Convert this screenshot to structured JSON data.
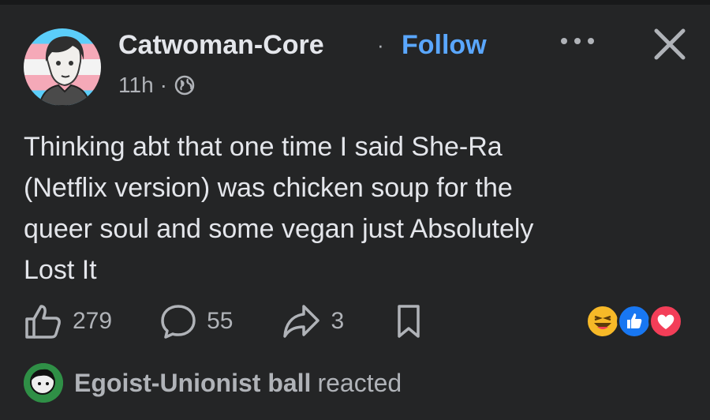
{
  "post": {
    "author": "Catwoman-Core",
    "separator": "·",
    "follow_label": "Follow",
    "time": "11h",
    "time_separator": "·",
    "privacy_icon": "globe-icon",
    "text": "Thinking abt that one time I said She-Ra\n(Netflix version) was chicken soup for the\nqueer soul and some vegan just Absolutely\nLost It"
  },
  "header": {
    "more_icon": "more-horizontal-icon",
    "close_icon": "close-icon"
  },
  "actions": {
    "like_icon": "thumbs-up-icon",
    "like_count": "279",
    "comment_icon": "comment-icon",
    "comment_count": "55",
    "share_icon": "share-icon",
    "share_count": "3",
    "save_icon": "bookmark-icon"
  },
  "reactions": [
    "haha-emoji",
    "like-emoji",
    "love-emoji"
  ],
  "reacted": {
    "name": "Egoist-Unionist ball",
    "verb": "reacted"
  },
  "colors": {
    "background": "#242526",
    "text": "#e4e6eb",
    "muted": "#b0b3b8",
    "follow": "#5aa7ff",
    "like_blue": "#1877f2",
    "love_red": "#f33e58",
    "haha_yellow": "#f7b928"
  }
}
